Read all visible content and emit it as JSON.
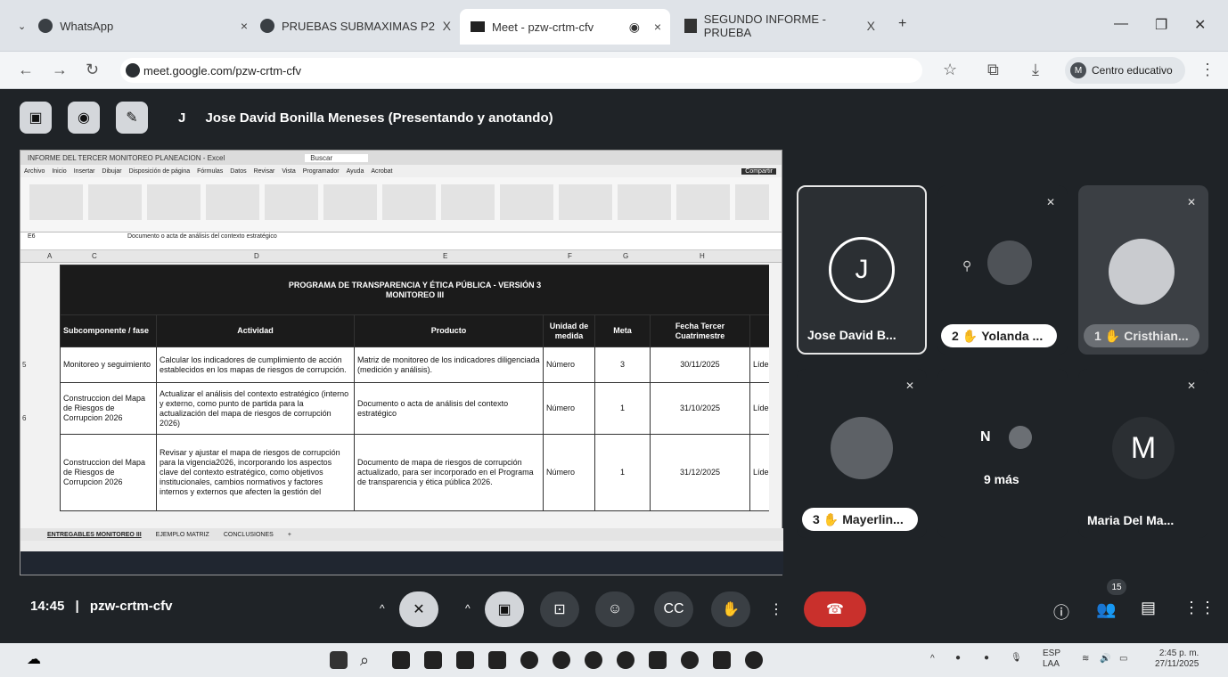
{
  "tabs": [
    {
      "label": "WhatsApp",
      "close": "×"
    },
    {
      "label": "PRUEBAS SUBMAXIMAS P2",
      "close": "X"
    },
    {
      "label": "Meet - pzw-crtm-cfv",
      "close": "×"
    },
    {
      "label": "SEGUNDO INFORME - PRUEBA",
      "close": "X"
    }
  ],
  "new_tab": "+",
  "address": {
    "url": "meet.google.com/pzw-crtm-cfv",
    "profile_initial": "M",
    "profile_label": "Centro educativo"
  },
  "meet": {
    "presenter_initial": "J",
    "presenter_text": "Jose David Bonilla Meneses (Presentando y anotando)",
    "meeting_time": "14:45",
    "separator": "|",
    "meeting_code": "pzw-crtm-cfv",
    "participants_count": "15",
    "tiles": [
      {
        "name": "Jose David B...",
        "initial": "J"
      },
      {
        "name": "Yolanda ...",
        "hand": "2"
      },
      {
        "name": "Cristhian...",
        "hand": "1"
      },
      {
        "name": "Mayerlin...",
        "hand": "3"
      },
      {
        "name": "9 más",
        "initial": "N"
      },
      {
        "name": "Maria Del Ma...",
        "initial": "M"
      }
    ]
  },
  "excel": {
    "title": "INFORME DEL TERCER MONITOREO PLANEACION - Excel",
    "search": "Buscar",
    "menu": [
      "Archivo",
      "Inicio",
      "Insertar",
      "Dibujar",
      "Disposición de página",
      "Fórmulas",
      "Datos",
      "Revisar",
      "Vista",
      "Programador",
      "Ayuda",
      "Acrobat"
    ],
    "share": "Compartir",
    "cell_ref": "E6",
    "formula": "Documento o acta de análisis del contexto estratégico",
    "columns": [
      "A",
      "C",
      "D",
      "E",
      "F",
      "G",
      "H"
    ],
    "banner_line1": "PROGRAMA DE TRANSPARENCIA Y ÉTICA PÚBLICA - VERSIÓN 3",
    "banner_line2": "MONITOREO III",
    "headers": [
      "Subcomponente / fase",
      "Actividad",
      "Producto",
      "Unidad de medida",
      "Meta",
      "Fecha Tercer Cuatrimestre"
    ],
    "rows": [
      {
        "num": "5",
        "sub": "Monitoreo y seguimiento",
        "act": "Calcular los indicadores de cumplimiento de acción establecidos en los mapas de riesgos de corrupción.",
        "prod": "Matriz de monitoreo de los indicadores diligenciada (medición y análisis).",
        "unit": "Número",
        "meta": "3",
        "date": "30/11/2025",
        "extra": "Líder"
      },
      {
        "num": "6",
        "sub": "Construccion del Mapa de Riesgos de Corrupcion 2026",
        "act": "Actualizar el análisis del contexto estratégico (interno y externo, como punto de partida para la actualización del mapa de riesgos de corrupción 2026)",
        "prod": "Documento o acta de análisis del contexto estratégico",
        "unit": "Número",
        "meta": "1",
        "date": "31/10/2025",
        "extra": "Líder"
      },
      {
        "num": "",
        "sub": "Construccion del Mapa de Riesgos de Corrupcion 2026",
        "act": "Revisar y ajustar el mapa de riesgos de corrupción para la vigencia2026, incorporando los aspectos clave del contexto estratégico, como objetivos institucionales, cambios normativos y factores internos y externos que afecten la gestión del",
        "prod": "Documento de mapa de riesgos de corrupción actualizado, para ser incorporado en el Programa de transparencia y ética pública 2026.",
        "unit": "Número",
        "meta": "1",
        "date": "31/12/2025",
        "extra": "Líder"
      }
    ],
    "sheet_tabs": [
      "ENTREGABLES MONITOREO III",
      "EJEMPLO MATRIZ",
      "CONCLUSIONES"
    ]
  },
  "taskbar": {
    "lang1": "ESP",
    "lang2": "LAA",
    "time": "2:45 p. m.",
    "date": "27/11/2025"
  }
}
